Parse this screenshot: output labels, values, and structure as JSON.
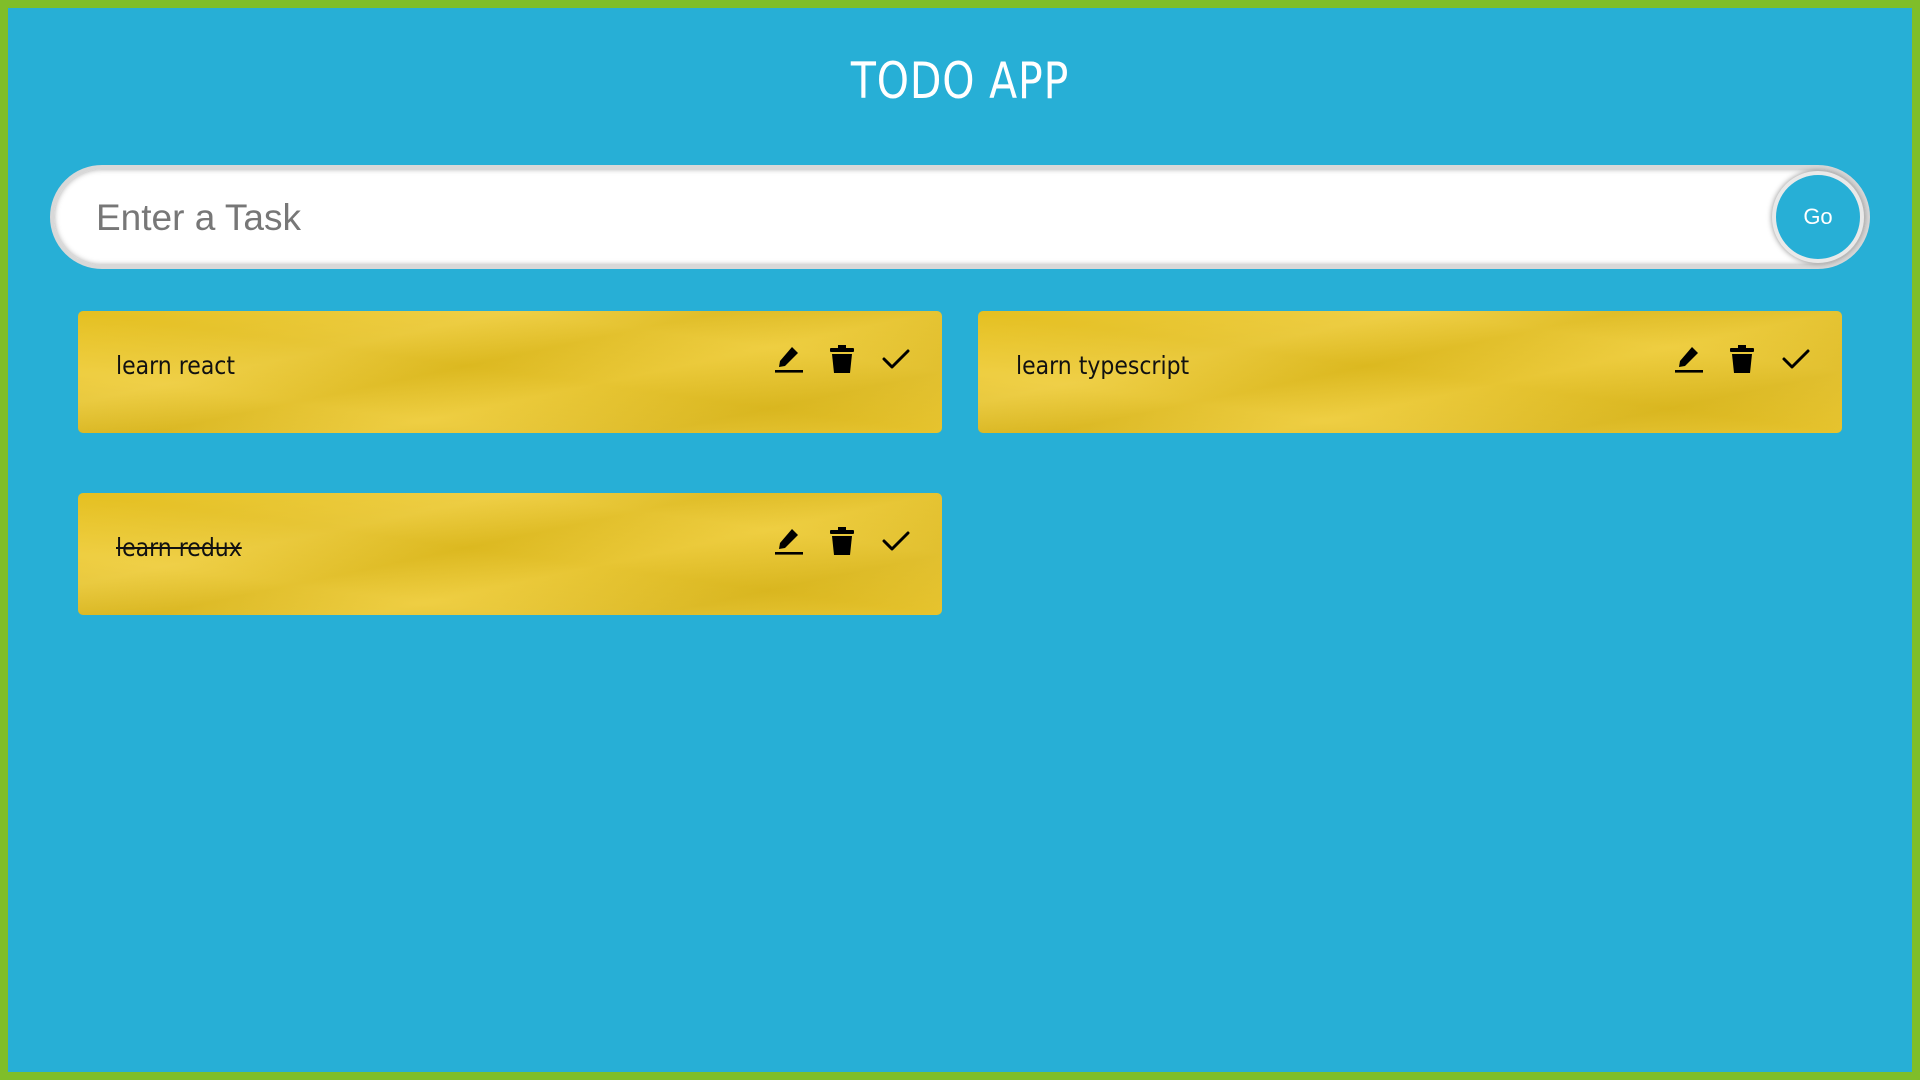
{
  "header": {
    "title": "TODO APP"
  },
  "task_form": {
    "placeholder": "Enter a Task",
    "value": "",
    "submit_label": "Go"
  },
  "tasks": [
    {
      "text": "learn react",
      "completed": false,
      "actions": [
        "edit-icon",
        "trash-icon",
        "check-icon"
      ]
    },
    {
      "text": "learn typescript",
      "completed": false,
      "actions": [
        "edit-icon",
        "trash-icon",
        "check-icon"
      ]
    },
    {
      "text": "learn redux",
      "completed": true,
      "actions": [
        "edit-icon",
        "trash-icon",
        "check-icon"
      ]
    }
  ],
  "colors": {
    "frame": "#7fbe2a",
    "background": "#27afd6",
    "card": "#ecc622",
    "text_dark": "#111111",
    "title": "#ffffff"
  }
}
